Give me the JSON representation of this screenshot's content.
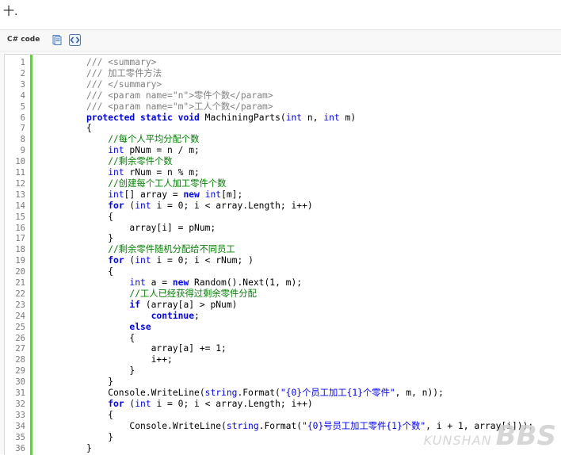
{
  "heading": "十.",
  "toolbar": {
    "lang_label": "C# code",
    "copy_icon": "copy-icon",
    "view_icon": "view-source-icon"
  },
  "code": {
    "lines": [
      "/// <summary>",
      "/// 加工零件方法",
      "/// </summary>",
      "/// <param name=\"n\">零件个数</param>",
      "/// <param name=\"m\">工人个数</param>",
      "protected static void MachiningParts(int n, int m)",
      "{",
      "    //每个人平均分配个数",
      "    int pNum = n / m;",
      "    //剩余零件个数",
      "    int rNum = n % m;",
      "    //创建每个工人加工零件个数",
      "    int[] array = new int[m];",
      "    for (int i = 0; i < array.Length; i++)",
      "    {",
      "        array[i] = pNum;",
      "    }",
      "    //剩余零件随机分配给不同员工",
      "    for (int i = 0; i < rNum; )",
      "    {",
      "        int a = new Random().Next(1, m);",
      "        //工人已经获得过剩余零件分配",
      "        if (array[a] > pNum)",
      "            continue;",
      "        else",
      "        {",
      "            array[a] += 1;",
      "            i++;",
      "        }",
      "    }",
      "    Console.WriteLine(string.Format(\"{0}个员工加工{1}个零件\", m, n));",
      "    for (int i = 0; i < array.Length; i++)",
      "    {",
      "        Console.WriteLine(string.Format(\"{0}号员工加工零件{1}个数\", i + 1, array[i]));",
      "    }",
      "}"
    ]
  },
  "watermark": {
    "small": "KUNSHAN",
    "big": "BBS"
  },
  "colors": {
    "keyword": "#0000ff",
    "comment": "#008200",
    "doc_comment": "#808080",
    "gutter_bar": "#6ac84a"
  }
}
